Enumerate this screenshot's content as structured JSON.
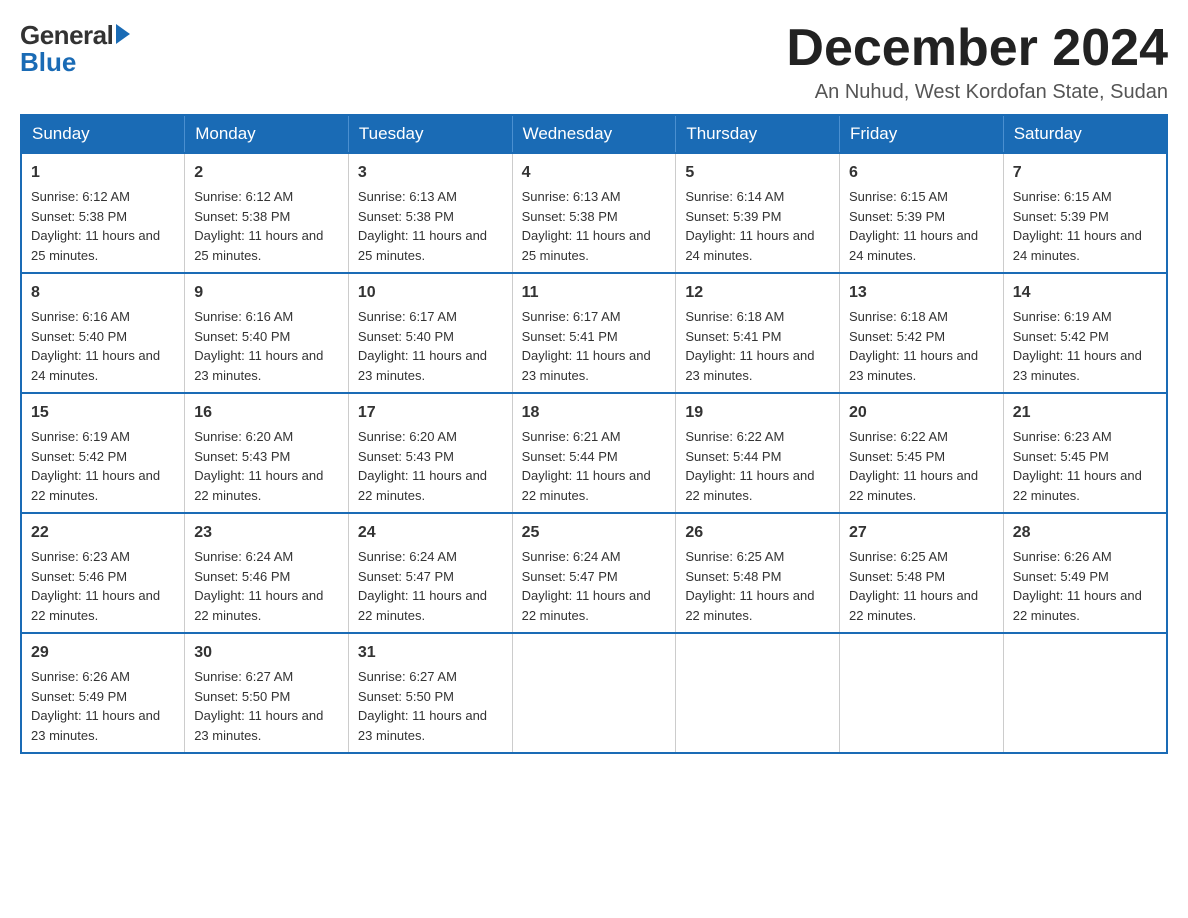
{
  "logo": {
    "general": "General",
    "blue": "Blue"
  },
  "title": "December 2024",
  "location": "An Nuhud, West Kordofan State, Sudan",
  "days": [
    "Sunday",
    "Monday",
    "Tuesday",
    "Wednesday",
    "Thursday",
    "Friday",
    "Saturday"
  ],
  "weeks": [
    [
      {
        "day": "1",
        "sunrise": "Sunrise: 6:12 AM",
        "sunset": "Sunset: 5:38 PM",
        "daylight": "Daylight: 11 hours and 25 minutes."
      },
      {
        "day": "2",
        "sunrise": "Sunrise: 6:12 AM",
        "sunset": "Sunset: 5:38 PM",
        "daylight": "Daylight: 11 hours and 25 minutes."
      },
      {
        "day": "3",
        "sunrise": "Sunrise: 6:13 AM",
        "sunset": "Sunset: 5:38 PM",
        "daylight": "Daylight: 11 hours and 25 minutes."
      },
      {
        "day": "4",
        "sunrise": "Sunrise: 6:13 AM",
        "sunset": "Sunset: 5:38 PM",
        "daylight": "Daylight: 11 hours and 25 minutes."
      },
      {
        "day": "5",
        "sunrise": "Sunrise: 6:14 AM",
        "sunset": "Sunset: 5:39 PM",
        "daylight": "Daylight: 11 hours and 24 minutes."
      },
      {
        "day": "6",
        "sunrise": "Sunrise: 6:15 AM",
        "sunset": "Sunset: 5:39 PM",
        "daylight": "Daylight: 11 hours and 24 minutes."
      },
      {
        "day": "7",
        "sunrise": "Sunrise: 6:15 AM",
        "sunset": "Sunset: 5:39 PM",
        "daylight": "Daylight: 11 hours and 24 minutes."
      }
    ],
    [
      {
        "day": "8",
        "sunrise": "Sunrise: 6:16 AM",
        "sunset": "Sunset: 5:40 PM",
        "daylight": "Daylight: 11 hours and 24 minutes."
      },
      {
        "day": "9",
        "sunrise": "Sunrise: 6:16 AM",
        "sunset": "Sunset: 5:40 PM",
        "daylight": "Daylight: 11 hours and 23 minutes."
      },
      {
        "day": "10",
        "sunrise": "Sunrise: 6:17 AM",
        "sunset": "Sunset: 5:40 PM",
        "daylight": "Daylight: 11 hours and 23 minutes."
      },
      {
        "day": "11",
        "sunrise": "Sunrise: 6:17 AM",
        "sunset": "Sunset: 5:41 PM",
        "daylight": "Daylight: 11 hours and 23 minutes."
      },
      {
        "day": "12",
        "sunrise": "Sunrise: 6:18 AM",
        "sunset": "Sunset: 5:41 PM",
        "daylight": "Daylight: 11 hours and 23 minutes."
      },
      {
        "day": "13",
        "sunrise": "Sunrise: 6:18 AM",
        "sunset": "Sunset: 5:42 PM",
        "daylight": "Daylight: 11 hours and 23 minutes."
      },
      {
        "day": "14",
        "sunrise": "Sunrise: 6:19 AM",
        "sunset": "Sunset: 5:42 PM",
        "daylight": "Daylight: 11 hours and 23 minutes."
      }
    ],
    [
      {
        "day": "15",
        "sunrise": "Sunrise: 6:19 AM",
        "sunset": "Sunset: 5:42 PM",
        "daylight": "Daylight: 11 hours and 22 minutes."
      },
      {
        "day": "16",
        "sunrise": "Sunrise: 6:20 AM",
        "sunset": "Sunset: 5:43 PM",
        "daylight": "Daylight: 11 hours and 22 minutes."
      },
      {
        "day": "17",
        "sunrise": "Sunrise: 6:20 AM",
        "sunset": "Sunset: 5:43 PM",
        "daylight": "Daylight: 11 hours and 22 minutes."
      },
      {
        "day": "18",
        "sunrise": "Sunrise: 6:21 AM",
        "sunset": "Sunset: 5:44 PM",
        "daylight": "Daylight: 11 hours and 22 minutes."
      },
      {
        "day": "19",
        "sunrise": "Sunrise: 6:22 AM",
        "sunset": "Sunset: 5:44 PM",
        "daylight": "Daylight: 11 hours and 22 minutes."
      },
      {
        "day": "20",
        "sunrise": "Sunrise: 6:22 AM",
        "sunset": "Sunset: 5:45 PM",
        "daylight": "Daylight: 11 hours and 22 minutes."
      },
      {
        "day": "21",
        "sunrise": "Sunrise: 6:23 AM",
        "sunset": "Sunset: 5:45 PM",
        "daylight": "Daylight: 11 hours and 22 minutes."
      }
    ],
    [
      {
        "day": "22",
        "sunrise": "Sunrise: 6:23 AM",
        "sunset": "Sunset: 5:46 PM",
        "daylight": "Daylight: 11 hours and 22 minutes."
      },
      {
        "day": "23",
        "sunrise": "Sunrise: 6:24 AM",
        "sunset": "Sunset: 5:46 PM",
        "daylight": "Daylight: 11 hours and 22 minutes."
      },
      {
        "day": "24",
        "sunrise": "Sunrise: 6:24 AM",
        "sunset": "Sunset: 5:47 PM",
        "daylight": "Daylight: 11 hours and 22 minutes."
      },
      {
        "day": "25",
        "sunrise": "Sunrise: 6:24 AM",
        "sunset": "Sunset: 5:47 PM",
        "daylight": "Daylight: 11 hours and 22 minutes."
      },
      {
        "day": "26",
        "sunrise": "Sunrise: 6:25 AM",
        "sunset": "Sunset: 5:48 PM",
        "daylight": "Daylight: 11 hours and 22 minutes."
      },
      {
        "day": "27",
        "sunrise": "Sunrise: 6:25 AM",
        "sunset": "Sunset: 5:48 PM",
        "daylight": "Daylight: 11 hours and 22 minutes."
      },
      {
        "day": "28",
        "sunrise": "Sunrise: 6:26 AM",
        "sunset": "Sunset: 5:49 PM",
        "daylight": "Daylight: 11 hours and 22 minutes."
      }
    ],
    [
      {
        "day": "29",
        "sunrise": "Sunrise: 6:26 AM",
        "sunset": "Sunset: 5:49 PM",
        "daylight": "Daylight: 11 hours and 23 minutes."
      },
      {
        "day": "30",
        "sunrise": "Sunrise: 6:27 AM",
        "sunset": "Sunset: 5:50 PM",
        "daylight": "Daylight: 11 hours and 23 minutes."
      },
      {
        "day": "31",
        "sunrise": "Sunrise: 6:27 AM",
        "sunset": "Sunset: 5:50 PM",
        "daylight": "Daylight: 11 hours and 23 minutes."
      },
      null,
      null,
      null,
      null
    ]
  ]
}
